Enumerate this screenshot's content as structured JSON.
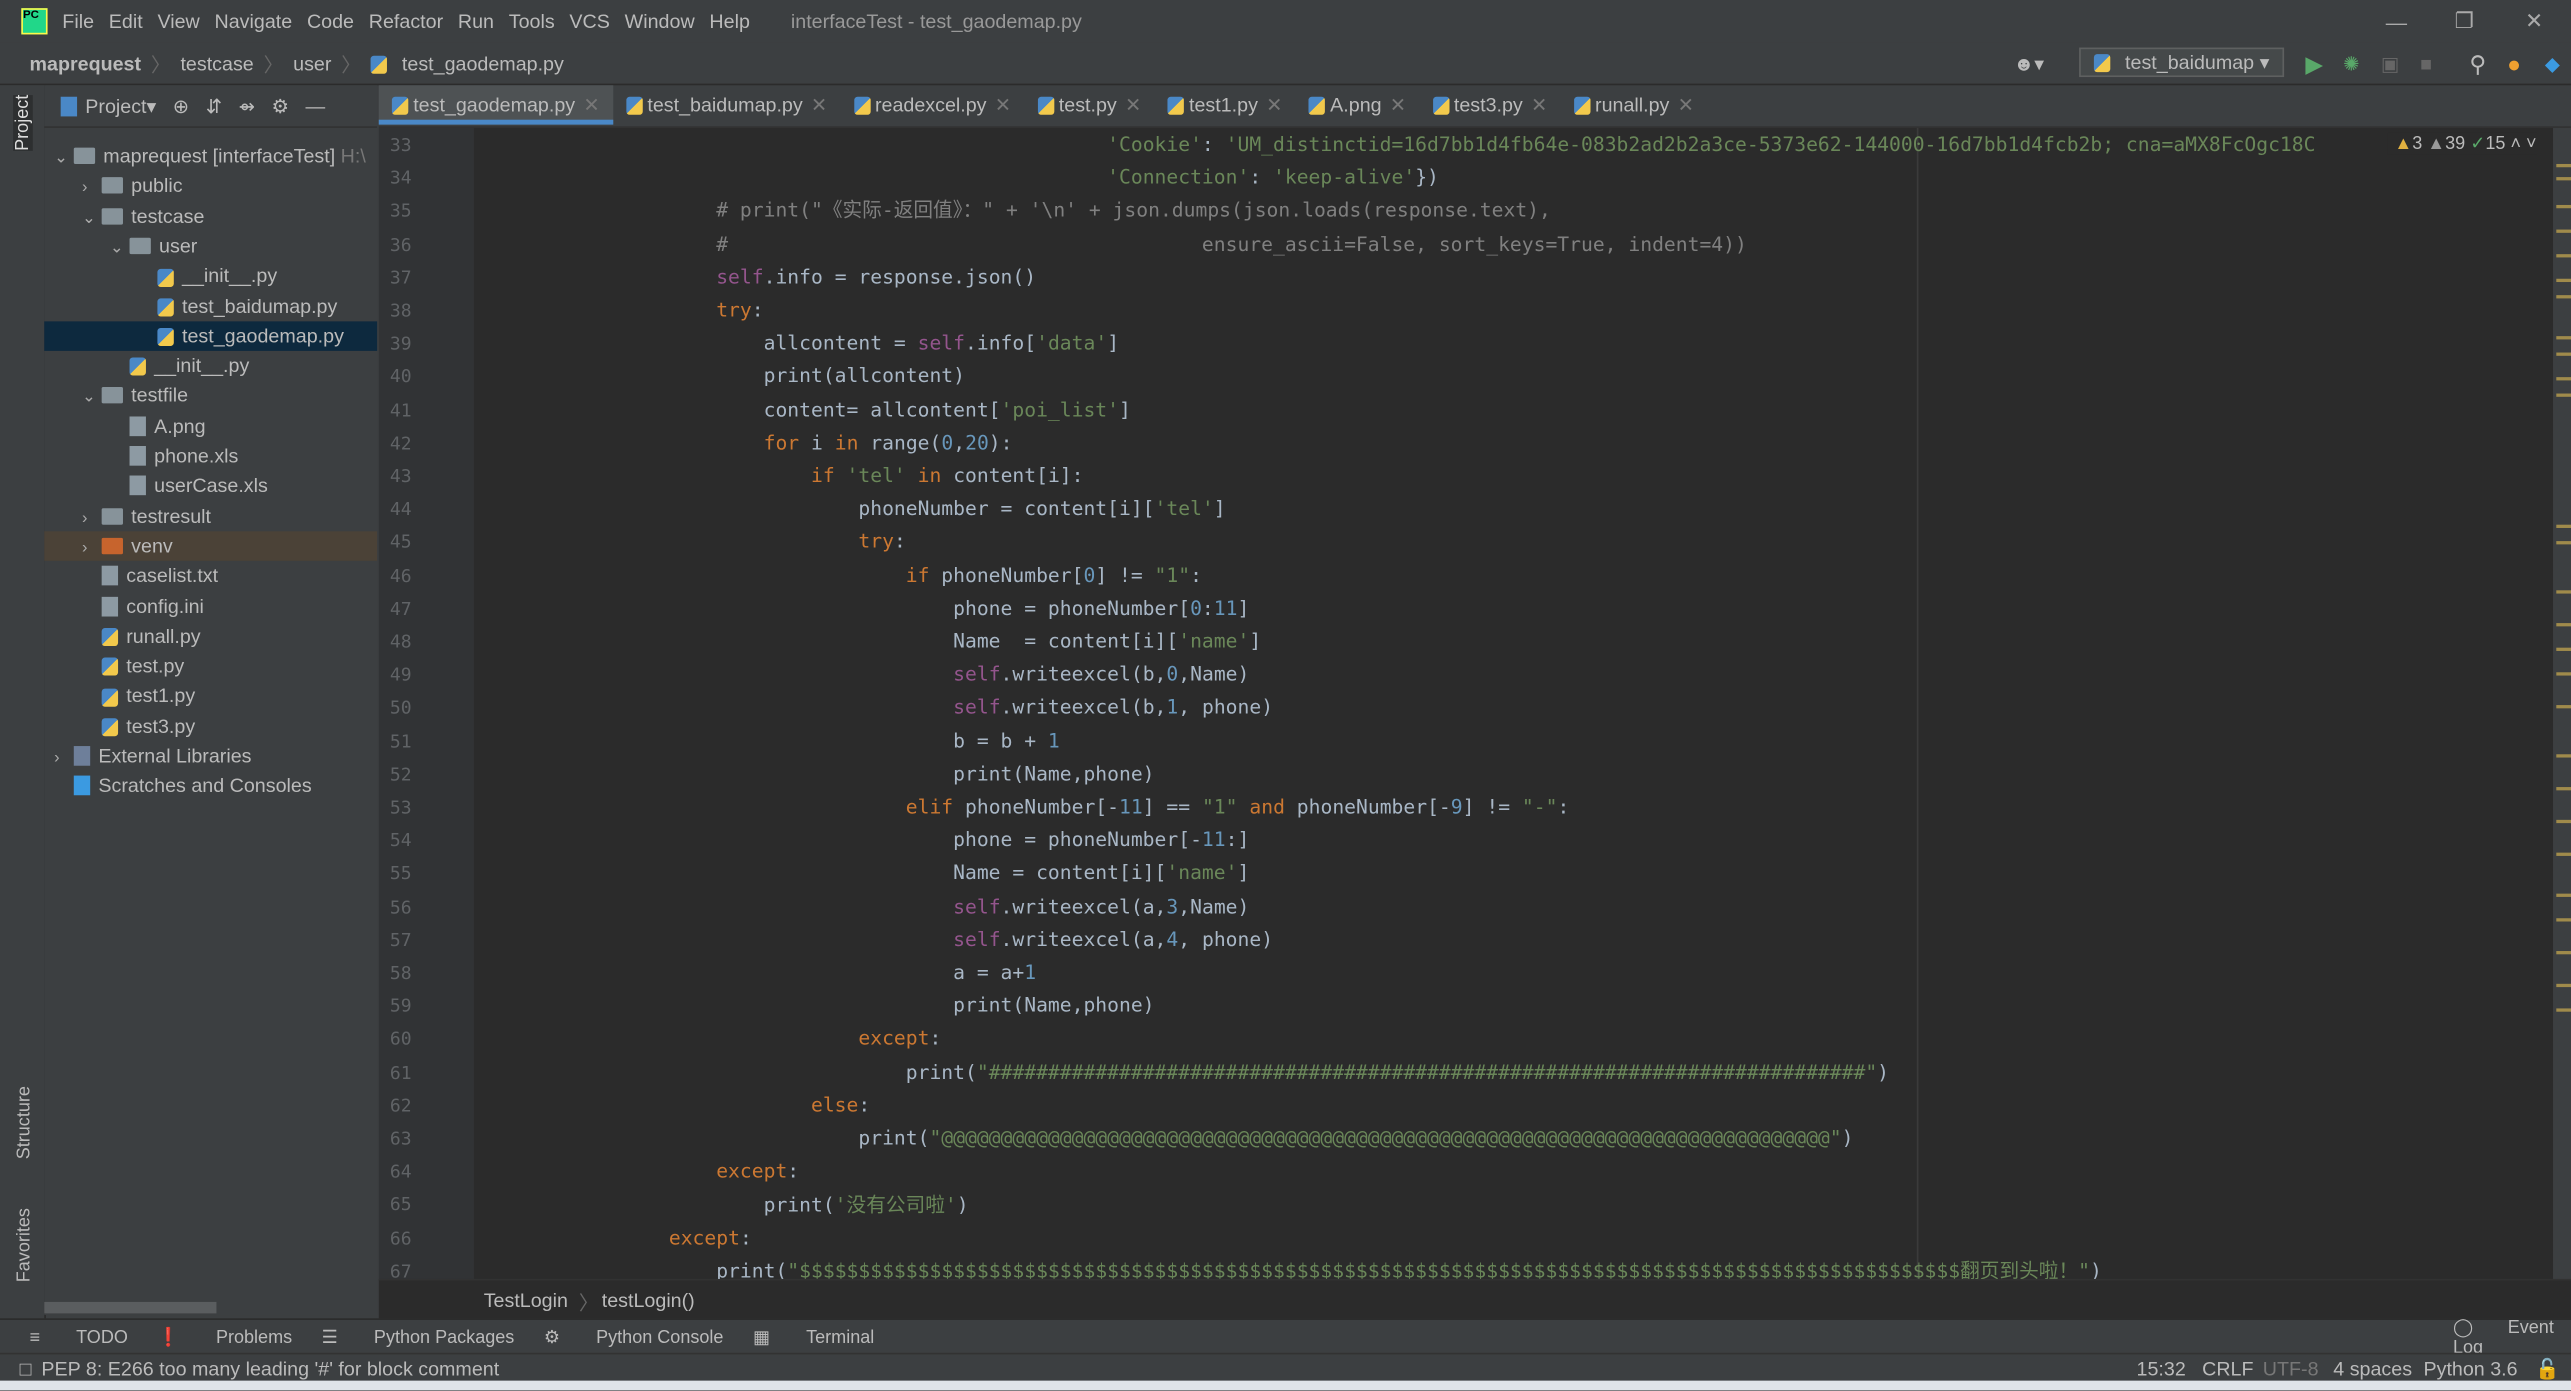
{
  "window": {
    "title": "interfaceTest - test_gaodemap.py",
    "menu": [
      "File",
      "Edit",
      "View",
      "Navigate",
      "Code",
      "Refactor",
      "Run",
      "Tools",
      "VCS",
      "Window",
      "Help"
    ]
  },
  "breadcrumb": [
    "maprequest",
    "testcase",
    "user",
    "test_gaodemap.py"
  ],
  "run_config": "test_baidumap",
  "side_tabs": {
    "project": "Project",
    "structure": "Structure",
    "favorites": "Favorites"
  },
  "project": {
    "label": "Project",
    "tree": [
      {
        "label": "maprequest [interfaceTest]",
        "suffix": "H:\\",
        "depth": 0,
        "type": "folder",
        "open": true
      },
      {
        "label": "public",
        "depth": 1,
        "type": "folder",
        "open": false
      },
      {
        "label": "testcase",
        "depth": 1,
        "type": "folder",
        "open": true
      },
      {
        "label": "user",
        "depth": 2,
        "type": "folder",
        "open": true
      },
      {
        "label": "__init__.py",
        "depth": 3,
        "type": "py"
      },
      {
        "label": "test_baidumap.py",
        "depth": 3,
        "type": "py"
      },
      {
        "label": "test_gaodemap.py",
        "depth": 3,
        "type": "py",
        "selected": true
      },
      {
        "label": "__init__.py",
        "depth": 2,
        "type": "py"
      },
      {
        "label": "testfile",
        "depth": 1,
        "type": "folder",
        "open": true
      },
      {
        "label": "A.png",
        "depth": 2,
        "type": "file"
      },
      {
        "label": "phone.xls",
        "depth": 2,
        "type": "file"
      },
      {
        "label": "userCase.xls",
        "depth": 2,
        "type": "file"
      },
      {
        "label": "testresult",
        "depth": 1,
        "type": "folder",
        "open": false
      },
      {
        "label": "venv",
        "depth": 1,
        "type": "folder",
        "open": false,
        "venv": true
      },
      {
        "label": "caselist.txt",
        "depth": 1,
        "type": "file"
      },
      {
        "label": "config.ini",
        "depth": 1,
        "type": "file"
      },
      {
        "label": "runall.py",
        "depth": 1,
        "type": "py"
      },
      {
        "label": "test.py",
        "depth": 1,
        "type": "py"
      },
      {
        "label": "test1.py",
        "depth": 1,
        "type": "py"
      },
      {
        "label": "test3.py",
        "depth": 1,
        "type": "py"
      },
      {
        "label": "External Libraries",
        "depth": 0,
        "type": "lib",
        "open": false
      },
      {
        "label": "Scratches and Consoles",
        "depth": 0,
        "type": "scratch"
      }
    ]
  },
  "tabs": [
    "test_gaodemap.py",
    "test_baidumap.py",
    "readexcel.py",
    "test.py",
    "test1.py",
    "A.png",
    "test3.py",
    "runall.py"
  ],
  "inspections": {
    "warnings": "3",
    "weak_warnings": "39",
    "ok": "15"
  },
  "code": {
    "first_line": 33,
    "lines": [
      "                                         'Cookie': 'UM_distinctid=16d7bb1d4fb64e-083b2ad2b2a3ce-5373e62-144000-16d7bb1d4fcb2b; cna=aMX8FcOgc18C",
      "                                         'Connection': 'keep-alive'})",
      "        # print(\"《实际-返回值》：\" + '\\n' + json.dumps(json.loads(response.text),",
      "        #                                        ensure_ascii=False, sort_keys=True, indent=4))",
      "        self.info = response.json()",
      "        try:",
      "            allcontent = self.info['data']",
      "            print(allcontent)",
      "            content= allcontent['poi_list']",
      "            for i in range(0,20):",
      "                if 'tel' in content[i]:",
      "                    phoneNumber = content[i]['tel']",
      "                    try:",
      "                        if phoneNumber[0] != \"1\":",
      "                            phone = phoneNumber[0:11]",
      "                            Name  = content[i]['name']",
      "                            self.writeexcel(b,0,Name)",
      "                            self.writeexcel(b,1, phone)",
      "                            b = b + 1",
      "                            print(Name,phone)",
      "                        elif phoneNumber[-11] == \"1\" and phoneNumber[-9] != \"-\":",
      "                            phone = phoneNumber[-11:]",
      "                            Name = content[i]['name']",
      "                            self.writeexcel(a,3,Name)",
      "                            self.writeexcel(a,4, phone)",
      "                            a = a+1",
      "                            print(Name,phone)",
      "                    except:",
      "                        print(\"##########################################################################\")",
      "                else:",
      "                    print(\"@@@@@@@@@@@@@@@@@@@@@@@@@@@@@@@@@@@@@@@@@@@@@@@@@@@@@@@@@@@@@@@@@@@@@@@@@@@\")",
      "        except:",
      "            print('没有公司啦')",
      "    except:",
      "        print(\"$$$$$$$$$$$$$$$$$$$$$$$$$$$$$$$$$$$$$$$$$$$$$$$$$$$$$$$$$$$$$$$$$$$$$$$$$$$$$$$$$$$$$$$$$$$$$$$$$$翻页到头啦！\")"
    ]
  },
  "editor_breadcrumb": [
    "TestLogin",
    "testLogin()"
  ],
  "tool_windows": [
    "TODO",
    "Problems",
    "Python Packages",
    "Python Console",
    "Terminal"
  ],
  "event_log": "Event Log",
  "status": {
    "message": "PEP 8: E266 too many leading '#' for block comment",
    "position": "15:32",
    "line_sep": "CRLF",
    "encoding": "UTF-8",
    "indent": "4 spaces",
    "interpreter": "Python 3.6"
  }
}
